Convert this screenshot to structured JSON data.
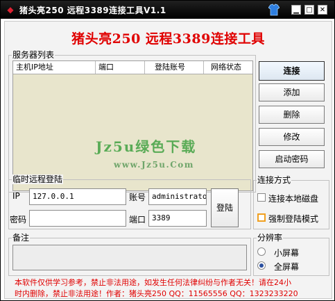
{
  "window": {
    "title": "猪头亮250 远程3389连接工具V1.1",
    "controls": {
      "minimize": "▁",
      "restore": "□",
      "close": "✕"
    }
  },
  "heading": "猪头亮250 远程3389连接工具",
  "server_list": {
    "label": "服务器列表",
    "columns": [
      "主机IP地址",
      "端口",
      "登陆账号",
      "网络状态"
    ],
    "rows": []
  },
  "watermark": {
    "brand": "Jz5u绿色下载",
    "url": "www.Jz5u.Com"
  },
  "side_buttons": {
    "connect": "连接",
    "add": "添加",
    "delete": "删除",
    "modify": "修改",
    "boot_password": "启动密码"
  },
  "temp_login": {
    "label": "临时远程登陆",
    "ip_label": "IP",
    "ip_value": "127.0.0.1",
    "account_label": "账号",
    "account_value": "administrator",
    "password_label": "密码",
    "password_value": "",
    "port_label": "端口",
    "port_value": "3389",
    "login_button": "登陆"
  },
  "connection_mode": {
    "label": "连接方式",
    "local_disk": {
      "label": "连接本地磁盘",
      "checked": false
    },
    "force_login": {
      "label": "强制登陆模式",
      "checked": true
    }
  },
  "notes": {
    "label": "备注",
    "value": ""
  },
  "resolution": {
    "label": "分辨率",
    "small": {
      "label": "小屏幕",
      "checked": false
    },
    "full": {
      "label": "全屏幕",
      "checked": true
    }
  },
  "footer": {
    "line1": "本软件仅供学习参考，禁止非法用途，如发生任何法律纠纷与作者无关！请在24小",
    "line2": "时内删除，禁止非法用途！作者：猪头亮250 QQ：11565556 QQ：1323233220"
  },
  "colors": {
    "heading": "#e00000",
    "watermark": "#4aa54a",
    "list_bg": "#e8e5cc"
  }
}
